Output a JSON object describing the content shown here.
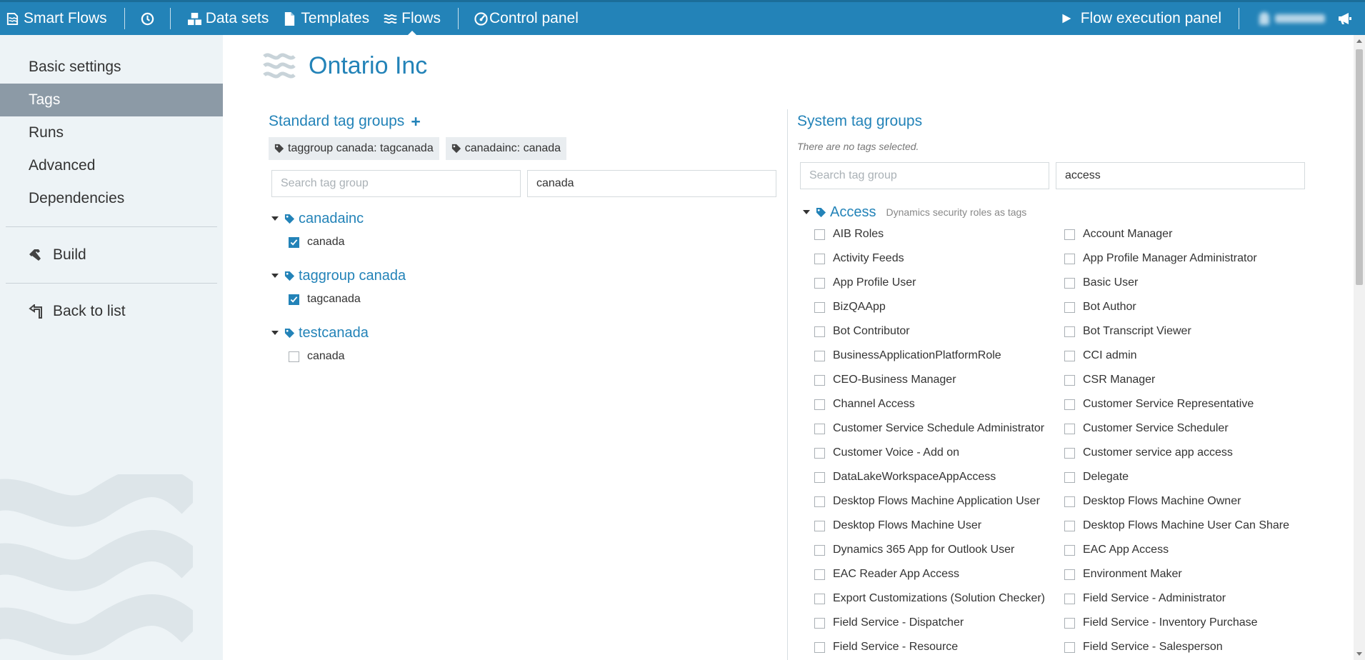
{
  "topbar": {
    "brand": "Smart Flows",
    "datasets": "Data sets",
    "templates": "Templates",
    "flows": "Flows",
    "control_panel": "Control panel",
    "flow_execution": "Flow execution panel",
    "accent": "#2383b8"
  },
  "sidebar": {
    "items": [
      {
        "label": "Basic settings"
      },
      {
        "label": "Tags"
      },
      {
        "label": "Runs"
      },
      {
        "label": "Advanced"
      },
      {
        "label": "Dependencies"
      }
    ],
    "build": "Build",
    "back": "Back to list"
  },
  "page": {
    "title": "Ontario Inc"
  },
  "standard": {
    "title": "Standard tag groups",
    "plus": "+",
    "chips": [
      "taggroup canada: tagcanada",
      "canadainc: canada"
    ],
    "search_placeholder": "Search tag group",
    "filter_value": "canada",
    "groups": [
      {
        "name": "canadainc",
        "items": [
          {
            "label": "canada",
            "checked": true
          }
        ]
      },
      {
        "name": "taggroup canada",
        "items": [
          {
            "label": "tagcanada",
            "checked": true
          }
        ]
      },
      {
        "name": "testcanada",
        "items": [
          {
            "label": "canada",
            "checked": false
          }
        ]
      }
    ]
  },
  "system": {
    "title": "System tag groups",
    "no_tags": "There are no tags selected.",
    "search_placeholder": "Search tag group",
    "filter_value": "access",
    "group_name": "Access",
    "group_desc": "Dynamics security roles as tags",
    "roles": [
      "AIB Roles",
      "Account Manager",
      "Activity Feeds",
      "App Profile Manager Administrator",
      "App Profile User",
      "Basic User",
      "BizQAApp",
      "Bot Author",
      "Bot Contributor",
      "Bot Transcript Viewer",
      "BusinessApplicationPlatformRole",
      "CCI admin",
      "CEO-Business Manager",
      "CSR Manager",
      "Channel Access",
      "Customer Service Representative",
      "Customer Service Schedule Administrator",
      "Customer Service Scheduler",
      "Customer Voice - Add on",
      "Customer service app access",
      "DataLakeWorkspaceAppAccess",
      "Delegate",
      "Desktop Flows Machine Application User",
      "Desktop Flows Machine Owner",
      "Desktop Flows Machine User",
      "Desktop Flows Machine User Can Share",
      "Dynamics 365 App for Outlook User",
      "EAC App Access",
      "EAC Reader App Access",
      "Environment Maker",
      "Export Customizations (Solution Checker)",
      "Field Service - Administrator",
      "Field Service - Dispatcher",
      "Field Service - Inventory Purchase",
      "Field Service - Resource",
      "Field Service - Salesperson"
    ]
  }
}
